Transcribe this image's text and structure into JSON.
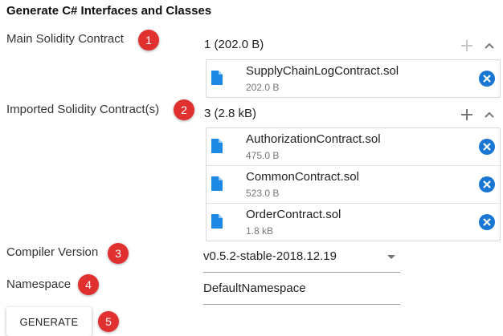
{
  "title": "Generate C# Interfaces and Classes",
  "main_contract": {
    "label": "Main Solidity Contract",
    "badge": "1",
    "count": "1 (202.0 B)",
    "files": [
      {
        "name": "SupplyChainLogContract.sol",
        "size": "202.0 B"
      }
    ]
  },
  "imported_contracts": {
    "label": "Imported Solidity Contract(s)",
    "badge": "2",
    "count": "3 (2.8 kB)",
    "files": [
      {
        "name": "AuthorizationContract.sol",
        "size": "475.0 B"
      },
      {
        "name": "CommonContract.sol",
        "size": "523.0 B"
      },
      {
        "name": "OrderContract.sol",
        "size": "1.8 kB"
      }
    ]
  },
  "compiler": {
    "label": "Compiler Version",
    "badge": "3",
    "value": "v0.5.2-stable-2018.12.19"
  },
  "namespace": {
    "label": "Namespace",
    "badge": "4",
    "value": "DefaultNamespace"
  },
  "generate": {
    "label": "GENERATE",
    "badge": "5"
  },
  "colors": {
    "badge": "#e03030",
    "file_icon": "#1e88e5",
    "remove_icon": "#1976d2",
    "header_icon_disabled": "#c8c8c8",
    "header_icon_active": "#777777"
  },
  "icons": {
    "add": "plus-icon",
    "collapse": "chevron-up-icon",
    "file": "file-icon",
    "remove": "close-circle-icon",
    "dropdown": "dropdown-arrow-icon"
  }
}
